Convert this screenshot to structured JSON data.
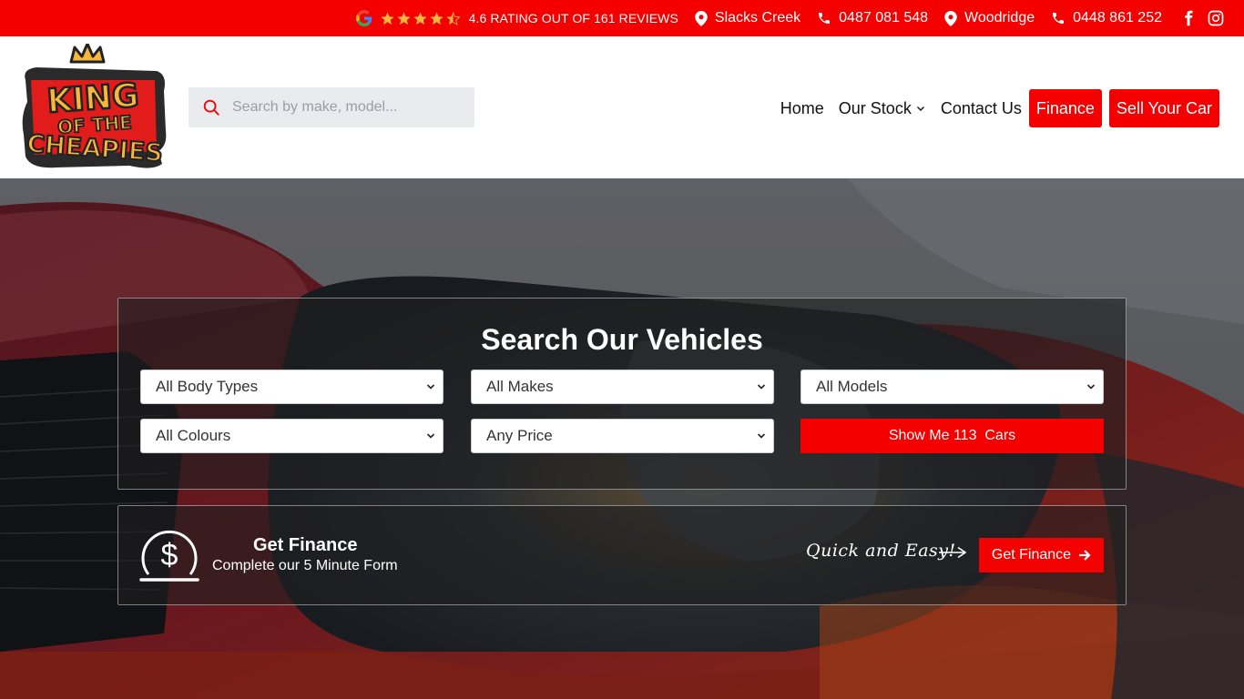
{
  "topbar": {
    "rating_text": "4.6 RATING OUT OF 161 REVIEWS",
    "rating_stars": 4.6,
    "locations": [
      {
        "name": "Slacks Creek",
        "phone": "0487 081 548"
      },
      {
        "name": "Woodridge",
        "phone": "0448 861 252"
      }
    ],
    "social": [
      "facebook-icon",
      "instagram-icon"
    ]
  },
  "header": {
    "logo_text": "KING OF THE CHEAPIES",
    "search_placeholder": "Search by make, model...",
    "nav": {
      "home": "Home",
      "stock": "Our Stock",
      "contact": "Contact Us",
      "finance": "Finance",
      "sell": "Sell Your Car"
    }
  },
  "search_panel": {
    "title": "Search Our Vehicles",
    "body_types": "All Body Types",
    "makes": "All Makes",
    "models": "All Models",
    "colours": "All Colours",
    "price": "Any Price",
    "show_button": "Show Me 113  Cars"
  },
  "finance_panel": {
    "title": "Get Finance",
    "subtitle": "Complete our 5 Minute Form",
    "tagline": "Quick and Easy!",
    "button": "Get Finance"
  },
  "colors": {
    "brand_red": "#f50000",
    "star_gold": "#f6b73c"
  }
}
